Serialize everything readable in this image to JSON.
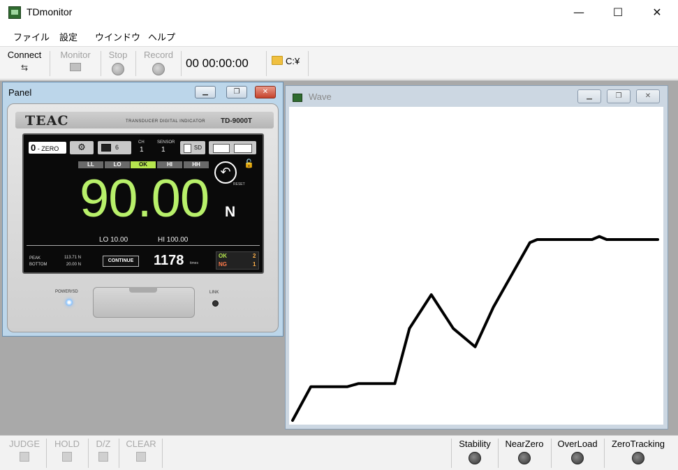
{
  "window": {
    "title": "TDmonitor",
    "min": "—",
    "max": "☐",
    "close": "✕"
  },
  "menu": [
    {
      "label": "ファイル"
    },
    {
      "label": "設定"
    },
    {
      "label": "ウインドウ"
    },
    {
      "label": "ヘルプ"
    }
  ],
  "toolbar": {
    "connect": "Connect",
    "monitor": "Monitor",
    "stop": "Stop",
    "record": "Record",
    "timer": "00 00:00:00",
    "path": "C:¥"
  },
  "panel": {
    "title": "Panel",
    "device": {
      "brand": "TEAC",
      "subtitle": "TRANSDUCER DIGITAL INDICATOR",
      "model": "TD-9000T",
      "zero_label": "ZERO",
      "zero_num": "0",
      "ch_value": "6",
      "ch_label": "CH",
      "ch_num": "1",
      "sensor_label": "SENSOR",
      "sensor_num": "1",
      "sd_label": "SD",
      "judges": [
        "LL",
        "LO",
        "OK",
        "HI",
        "HH"
      ],
      "active_judge": "OK",
      "return_label": "RESET",
      "value": "90.00",
      "unit": "N",
      "lo": "LO   10.00",
      "hi": "HI   100.00",
      "peak_label": "PEAK",
      "bottom_label": "BOTTOM",
      "peak_value": "113.71 N",
      "bottom_value": "20.00 N",
      "continue": "CONTINUE",
      "count": "1178",
      "count_unit": "times",
      "ok_label": "OK",
      "ok_value": "2",
      "ng_label": "NG",
      "ng_value": "1",
      "power_label": "POWER/SD",
      "link_label": "LINK"
    }
  },
  "wave": {
    "title": "Wave"
  },
  "wave_trace": {
    "color": "#000000",
    "points": [
      [
        0.0,
        0.0
      ],
      [
        0.05,
        0.11
      ],
      [
        0.1,
        0.11
      ],
      [
        0.15,
        0.11
      ],
      [
        0.18,
        0.12
      ],
      [
        0.22,
        0.12
      ],
      [
        0.27,
        0.12
      ],
      [
        0.28,
        0.12
      ],
      [
        0.32,
        0.3
      ],
      [
        0.38,
        0.41
      ],
      [
        0.44,
        0.3
      ],
      [
        0.5,
        0.24
      ],
      [
        0.55,
        0.37
      ],
      [
        0.65,
        0.58
      ],
      [
        0.67,
        0.59
      ],
      [
        0.75,
        0.59
      ],
      [
        0.82,
        0.59
      ],
      [
        0.84,
        0.6
      ],
      [
        0.86,
        0.59
      ],
      [
        0.95,
        0.59
      ],
      [
        1.0,
        0.59
      ]
    ]
  },
  "statusbar": {
    "buttons": [
      "JUDGE",
      "HOLD",
      "D/Z",
      "CLEAR"
    ],
    "indicators": [
      "Stability",
      "NearZero",
      "OverLoad",
      "ZeroTracking"
    ]
  },
  "colors": {
    "display_value": "#b8f06a",
    "ok_active": "#b6e64e",
    "ng_orange": "#ffb14a",
    "close_red": "#c5432b"
  }
}
